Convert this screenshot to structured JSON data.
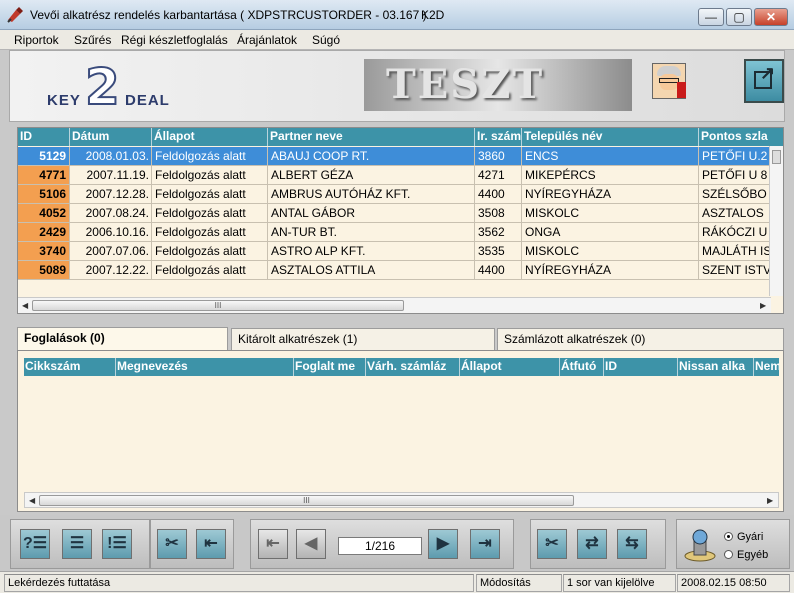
{
  "window": {
    "title": "Vevői alkatrész rendelés karbantartása ( XDPSTRCUSTORDER - 03.167 )",
    "k2d": "K2D",
    "min_glyph": "—",
    "max_glyph": "▢",
    "close_glyph": "✕"
  },
  "menu": [
    "Riportok",
    "Szűrés",
    "Régi készletfoglalás",
    "Árajánlatok",
    "Súgó"
  ],
  "logo": {
    "key": "KEY",
    "two": "2",
    "deal": "DEAL"
  },
  "banner_text": "TESZT",
  "orders_table": {
    "columns": [
      "ID",
      "Dátum",
      "Állapot",
      "Partner neve",
      "Ir. szám",
      "Település név",
      "Pontos szla"
    ],
    "rows": [
      {
        "id": "5129",
        "date": "2008.01.03.",
        "status": "Feldolgozás alatt",
        "partner": "ABAUJ COOP RT.",
        "zip": "3860",
        "city": "ENCS",
        "address": "PETŐFI U.2"
      },
      {
        "id": "4771",
        "date": "2007.11.19.",
        "status": "Feldolgozás alatt",
        "partner": "ALBERT GÉZA",
        "zip": "4271",
        "city": "MIKEPÉRCS",
        "address": "PETŐFI U 8"
      },
      {
        "id": "5106",
        "date": "2007.12.28.",
        "status": "Feldolgozás alatt",
        "partner": "AMBRUS AUTÓHÁZ KFT.",
        "zip": "4400",
        "city": "NYÍREGYHÁZA",
        "address": "SZÉLSŐBO"
      },
      {
        "id": "4052",
        "date": "2007.08.24.",
        "status": "Feldolgozás alatt",
        "partner": "ANTAL GÁBOR",
        "zip": "3508",
        "city": "MISKOLC",
        "address": "ASZTALOS"
      },
      {
        "id": "2429",
        "date": "2006.10.16.",
        "status": "Feldolgozás alatt",
        "partner": "AN-TUR BT.",
        "zip": "3562",
        "city": "ONGA",
        "address": "RÁKÓCZI U"
      },
      {
        "id": "3740",
        "date": "2007.07.06.",
        "status": "Feldolgozás alatt",
        "partner": "ASTRO ALP KFT.",
        "zip": "3535",
        "city": "MISKOLC",
        "address": "MAJLÁTH IS"
      },
      {
        "id": "5089",
        "date": "2007.12.22.",
        "status": "Feldolgozás alatt",
        "partner": "ASZTALOS ATTILA",
        "zip": "4400",
        "city": "NYÍREGYHÁZA",
        "address": "SZENT ISTV"
      }
    ]
  },
  "tabs": [
    "Foglalások (0)",
    "Kitárolt alkatrészek (1)",
    "Számlázott alkatrészek (0)"
  ],
  "detail_table": {
    "columns": [
      "Cikkszám",
      "Megnevezés",
      "Foglalt me",
      "Várh. számláz",
      "Állapot",
      "Átfutó",
      "ID",
      "Nissan alka",
      "Nem"
    ]
  },
  "scroll_grip": "III",
  "pager": {
    "text": "1/216"
  },
  "toolbar_glyphs": {
    "help": "?☰",
    "list": "☰",
    "list_alert": "!☰",
    "tools": "✂",
    "back": "⇤",
    "first": "⇤",
    "prev": "◀",
    "next": "▶",
    "last": "⇥",
    "cut": "✂",
    "swap": "⇄",
    "transfer": "⇆"
  },
  "radio": {
    "gyari": "Gyári",
    "egyeb": "Egyéb",
    "selected": "gyari"
  },
  "status": {
    "left": "Lekérdezés futtatása",
    "mode": "Módosítás",
    "selection": "1 sor van kijelölve",
    "datetime": "2008.02.15 08:50"
  }
}
